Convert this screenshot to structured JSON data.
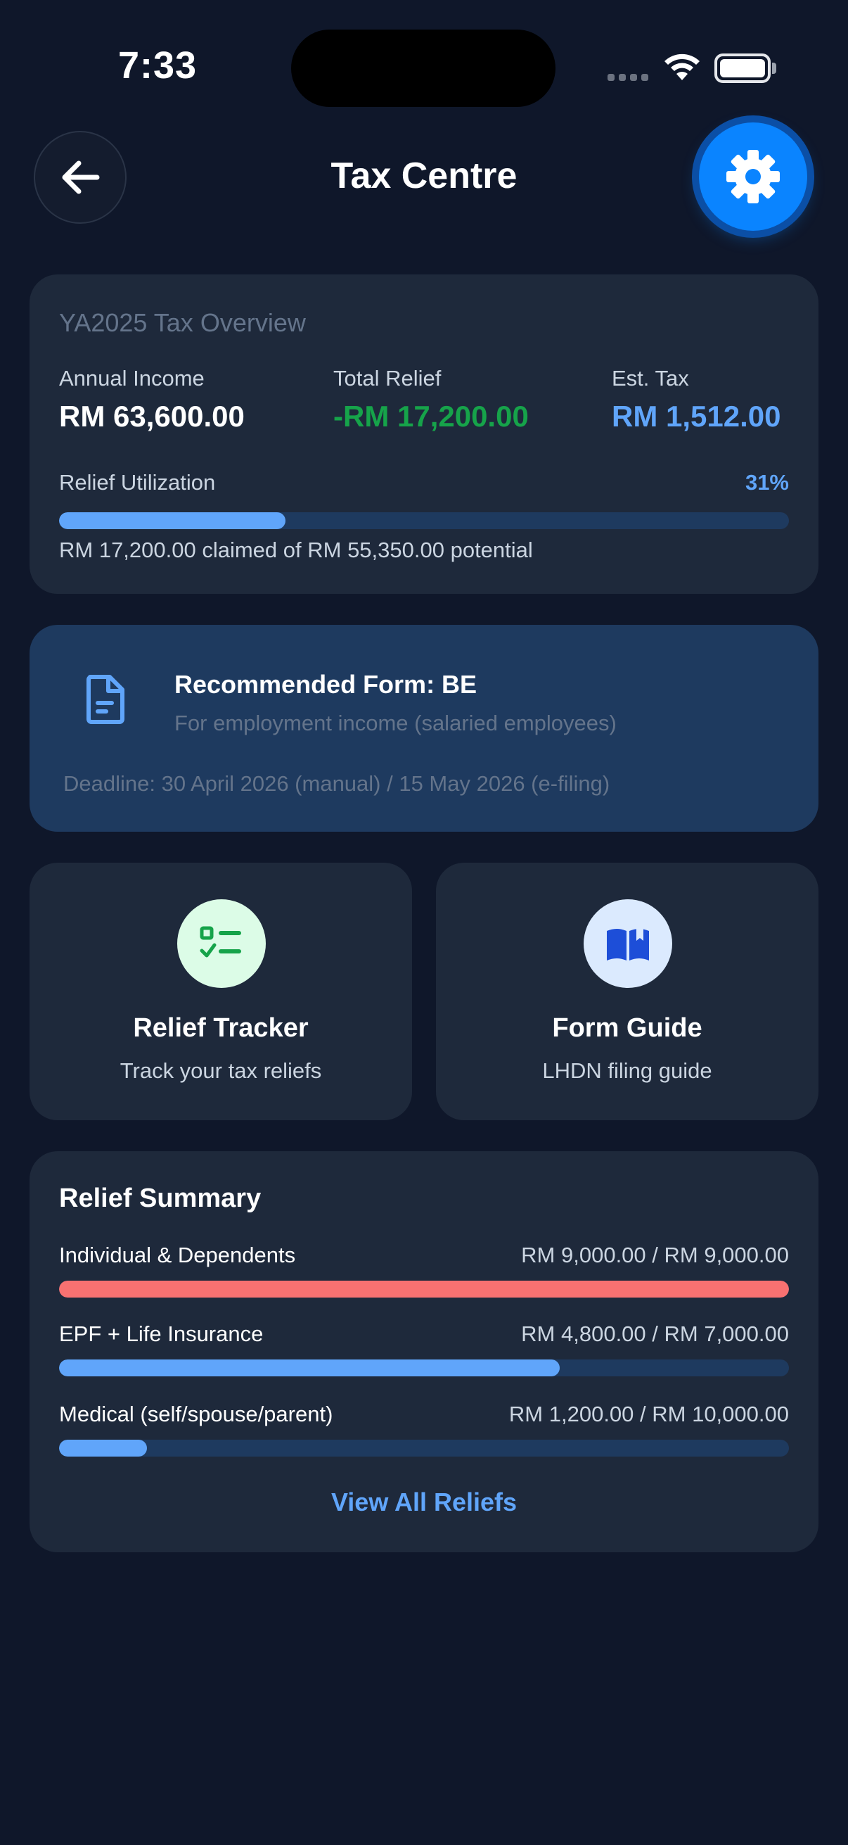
{
  "status_bar": {
    "time": "7:33"
  },
  "header": {
    "title": "Tax Centre",
    "back_icon": "arrow-left-icon",
    "settings_icon": "gear-icon"
  },
  "overview": {
    "title": "YA2025 Tax Overview",
    "annual_income_label": "Annual Income",
    "annual_income_value": "RM 63,600.00",
    "total_relief_label": "Total Relief",
    "total_relief_value": "-RM 17,200.00",
    "est_tax_label": "Est. Tax",
    "est_tax_value": "RM 1,512.00",
    "utilization_label": "Relief Utilization",
    "utilization_pct_text": "31%",
    "utilization_fraction": 0.31,
    "utilization_note": "RM 17,200.00 claimed of RM 55,350.00 potential"
  },
  "form": {
    "icon": "document-icon",
    "title": "Recommended Form: BE",
    "subtitle": "For employment income (salaried employees)",
    "deadline": "Deadline: 30 April 2026 (manual) / 15 May 2026 (e-filing)"
  },
  "tiles": [
    {
      "icon": "checklist-icon",
      "title": "Relief Tracker",
      "subtitle": "Track your tax reliefs"
    },
    {
      "icon": "book-icon",
      "title": "Form Guide",
      "subtitle": "LHDN filing guide"
    }
  ],
  "summary": {
    "title": "Relief Summary",
    "items": [
      {
        "name": "Individual & Dependents",
        "amount": "RM 9,000.00 / RM 9,000.00",
        "fraction": 1.0,
        "color": "#f87171"
      },
      {
        "name": "EPF + Life Insurance",
        "amount": "RM 4,800.00 / RM 7,000.00",
        "fraction": 0.686,
        "color": "#60a5fa"
      },
      {
        "name": "Medical (self/spouse/parent)",
        "amount": "RM 1,200.00 / RM 10,000.00",
        "fraction": 0.12,
        "color": "#60a5fa"
      }
    ],
    "view_all_label": "View All Reliefs"
  },
  "colors": {
    "background": "#0f172a",
    "card": "#1e293b",
    "accent_blue": "#60a5fa",
    "positive_green": "#16a34a",
    "settings_blue": "#0a84ff"
  }
}
